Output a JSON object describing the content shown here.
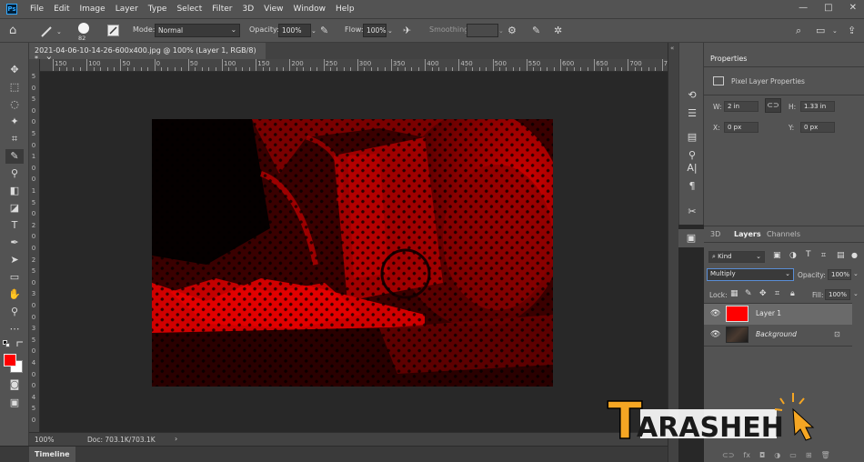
{
  "app": {
    "logo_text": "Ps"
  },
  "menu": [
    "File",
    "Edit",
    "Image",
    "Layer",
    "Type",
    "Select",
    "Filter",
    "3D",
    "View",
    "Window",
    "Help"
  ],
  "window_controls": [
    "—",
    "□",
    "✕"
  ],
  "options_bar": {
    "brush_size": "82",
    "mode_label": "Mode:",
    "mode_value": "Normal",
    "opacity_label": "Opacity:",
    "opacity_value": "100%",
    "flow_label": "Flow:",
    "flow_value": "100%",
    "smoothing_label": "Smoothing:",
    "smoothing_value": ""
  },
  "document": {
    "tab_title": "2021-04-06-10-14-26-600x400.jpg @ 100% (Layer 1, RGB/8) *",
    "tab_close": "×",
    "zoom": "100%",
    "doc_info": "Doc: 703.1K/703.1K"
  },
  "rulers": {
    "horizontal": [
      "150",
      "100",
      "50",
      "0",
      "50",
      "100",
      "150",
      "200",
      "250",
      "300",
      "350",
      "400",
      "450",
      "500",
      "550",
      "600",
      "650",
      "700",
      "750"
    ],
    "vertical": [
      "5",
      "0",
      "5",
      "0",
      "0",
      "5",
      "0",
      "1",
      "0",
      "0",
      "1",
      "5",
      "0",
      "2",
      "0",
      "0",
      "2",
      "5",
      "0",
      "3",
      "0",
      "0",
      "3",
      "5",
      "0",
      "4",
      "0",
      "0",
      "4",
      "5",
      "0"
    ]
  },
  "timeline": {
    "label": "Timeline"
  },
  "properties": {
    "tab": "Properties",
    "section": "Pixel Layer Properties",
    "w_label": "W:",
    "w_value": "2 in",
    "h_label": "H:",
    "h_value": "1.33 in",
    "x_label": "X:",
    "x_value": "0 px",
    "y_label": "Y:",
    "y_value": "0 px"
  },
  "layers_panel": {
    "tabs": [
      "3D",
      "Layers",
      "Channels"
    ],
    "filter_kind": "Kind",
    "blend_mode": "Multiply",
    "opacity_label": "Opacity:",
    "opacity_value": "100%",
    "lock_label": "Lock:",
    "fill_label": "Fill:",
    "fill_value": "100%",
    "layers": [
      {
        "name": "Layer 1"
      },
      {
        "name": "Background"
      }
    ]
  },
  "watermark": {
    "text": "TARASHEH"
  },
  "colors": {
    "foreground": "#ff0000",
    "background": "#ffffff",
    "accent": "#f5a623",
    "ui_panel": "#535353"
  }
}
